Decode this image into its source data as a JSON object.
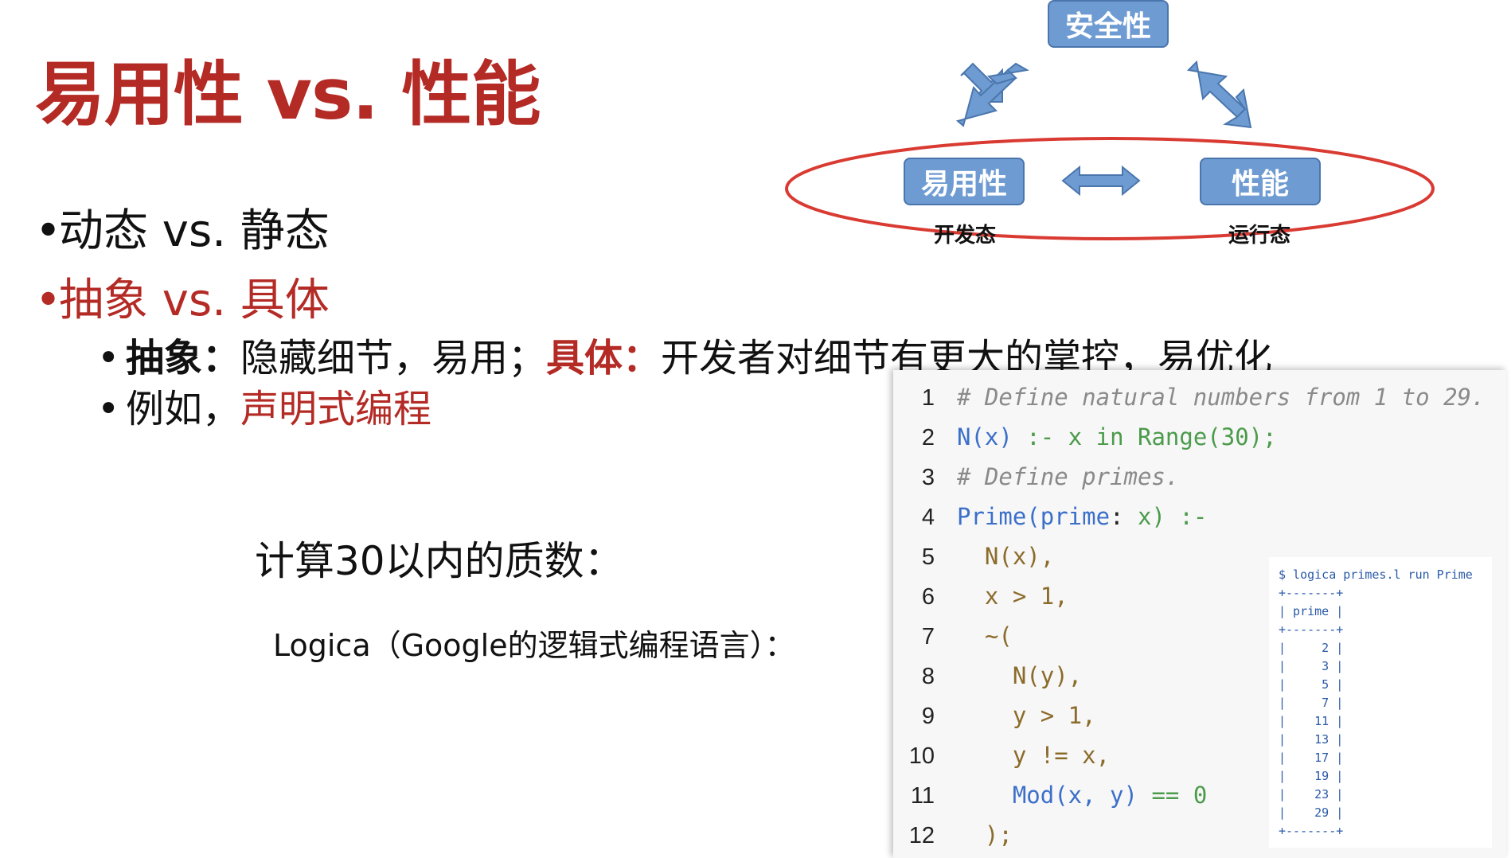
{
  "slide": {
    "title": "易用性 vs. 性能",
    "bullets": {
      "b1": "动态 vs. 静态",
      "b2": "抽象 vs. 具体",
      "b3": {
        "lead": "抽象：",
        "lead_text": "隐藏细节，易用；",
        "red_lead": "具体：",
        "red_text": "开发者对细节有更大的掌控，易优化"
      },
      "b4": {
        "text": "例如，",
        "red_text": "声明式编程"
      },
      "bullet_symbol": "•"
    },
    "compute_label": "计算30以内的质数：",
    "logica_label": "Logica（Google的逻辑式编程语言）："
  },
  "diagram": {
    "top": "安全性",
    "left": "易用性",
    "right": "性能",
    "left_sub": "开发态",
    "right_sub": "运行态",
    "box_color": "#6e9bd1",
    "ellipse_color": "#d93a32"
  },
  "code": {
    "lines": [
      {
        "n": "1",
        "tokens": [
          {
            "t": "# Define natural numbers from 1 to 29.",
            "c": "comment"
          }
        ]
      },
      {
        "n": "2",
        "tokens": [
          {
            "t": "N(x)",
            "c": "fn"
          },
          {
            "t": " :- ",
            "c": "op"
          },
          {
            "t": "x",
            "c": "op"
          },
          {
            "t": " in ",
            "c": "kw"
          },
          {
            "t": "Range(30);",
            "c": "op"
          }
        ]
      },
      {
        "n": "3",
        "tokens": [
          {
            "t": "# Define primes.",
            "c": "comment"
          }
        ]
      },
      {
        "n": "4",
        "tokens": [
          {
            "t": "Prime(prime",
            "c": "fn"
          },
          {
            "t": ": ",
            "c": "plain"
          },
          {
            "t": "x",
            "c": "op"
          },
          {
            "t": ") :-",
            "c": "op"
          }
        ]
      },
      {
        "n": "5",
        "tokens": [
          {
            "t": "  N(x),",
            "c": "var"
          }
        ]
      },
      {
        "n": "6",
        "tokens": [
          {
            "t": "  x > 1,",
            "c": "var"
          }
        ]
      },
      {
        "n": "7",
        "tokens": [
          {
            "t": "  ~(",
            "c": "var"
          }
        ]
      },
      {
        "n": "8",
        "tokens": [
          {
            "t": "    N(y),",
            "c": "var"
          }
        ]
      },
      {
        "n": "9",
        "tokens": [
          {
            "t": "    y > 1,",
            "c": "var"
          }
        ]
      },
      {
        "n": "10",
        "tokens": [
          {
            "t": "    y != x,",
            "c": "var"
          }
        ]
      },
      {
        "n": "11",
        "tokens": [
          {
            "t": "    Mod(x, y)",
            "c": "fn"
          },
          {
            "t": " == 0",
            "c": "num"
          }
        ]
      },
      {
        "n": "12",
        "tokens": [
          {
            "t": "  );",
            "c": "var"
          }
        ]
      }
    ]
  },
  "terminal": {
    "command": "$ logica primes.l run Prime",
    "border": "+-------+",
    "header": "| prime |",
    "values": [
      "2",
      "3",
      "5",
      "7",
      "11",
      "13",
      "17",
      "19",
      "23",
      "29"
    ]
  }
}
